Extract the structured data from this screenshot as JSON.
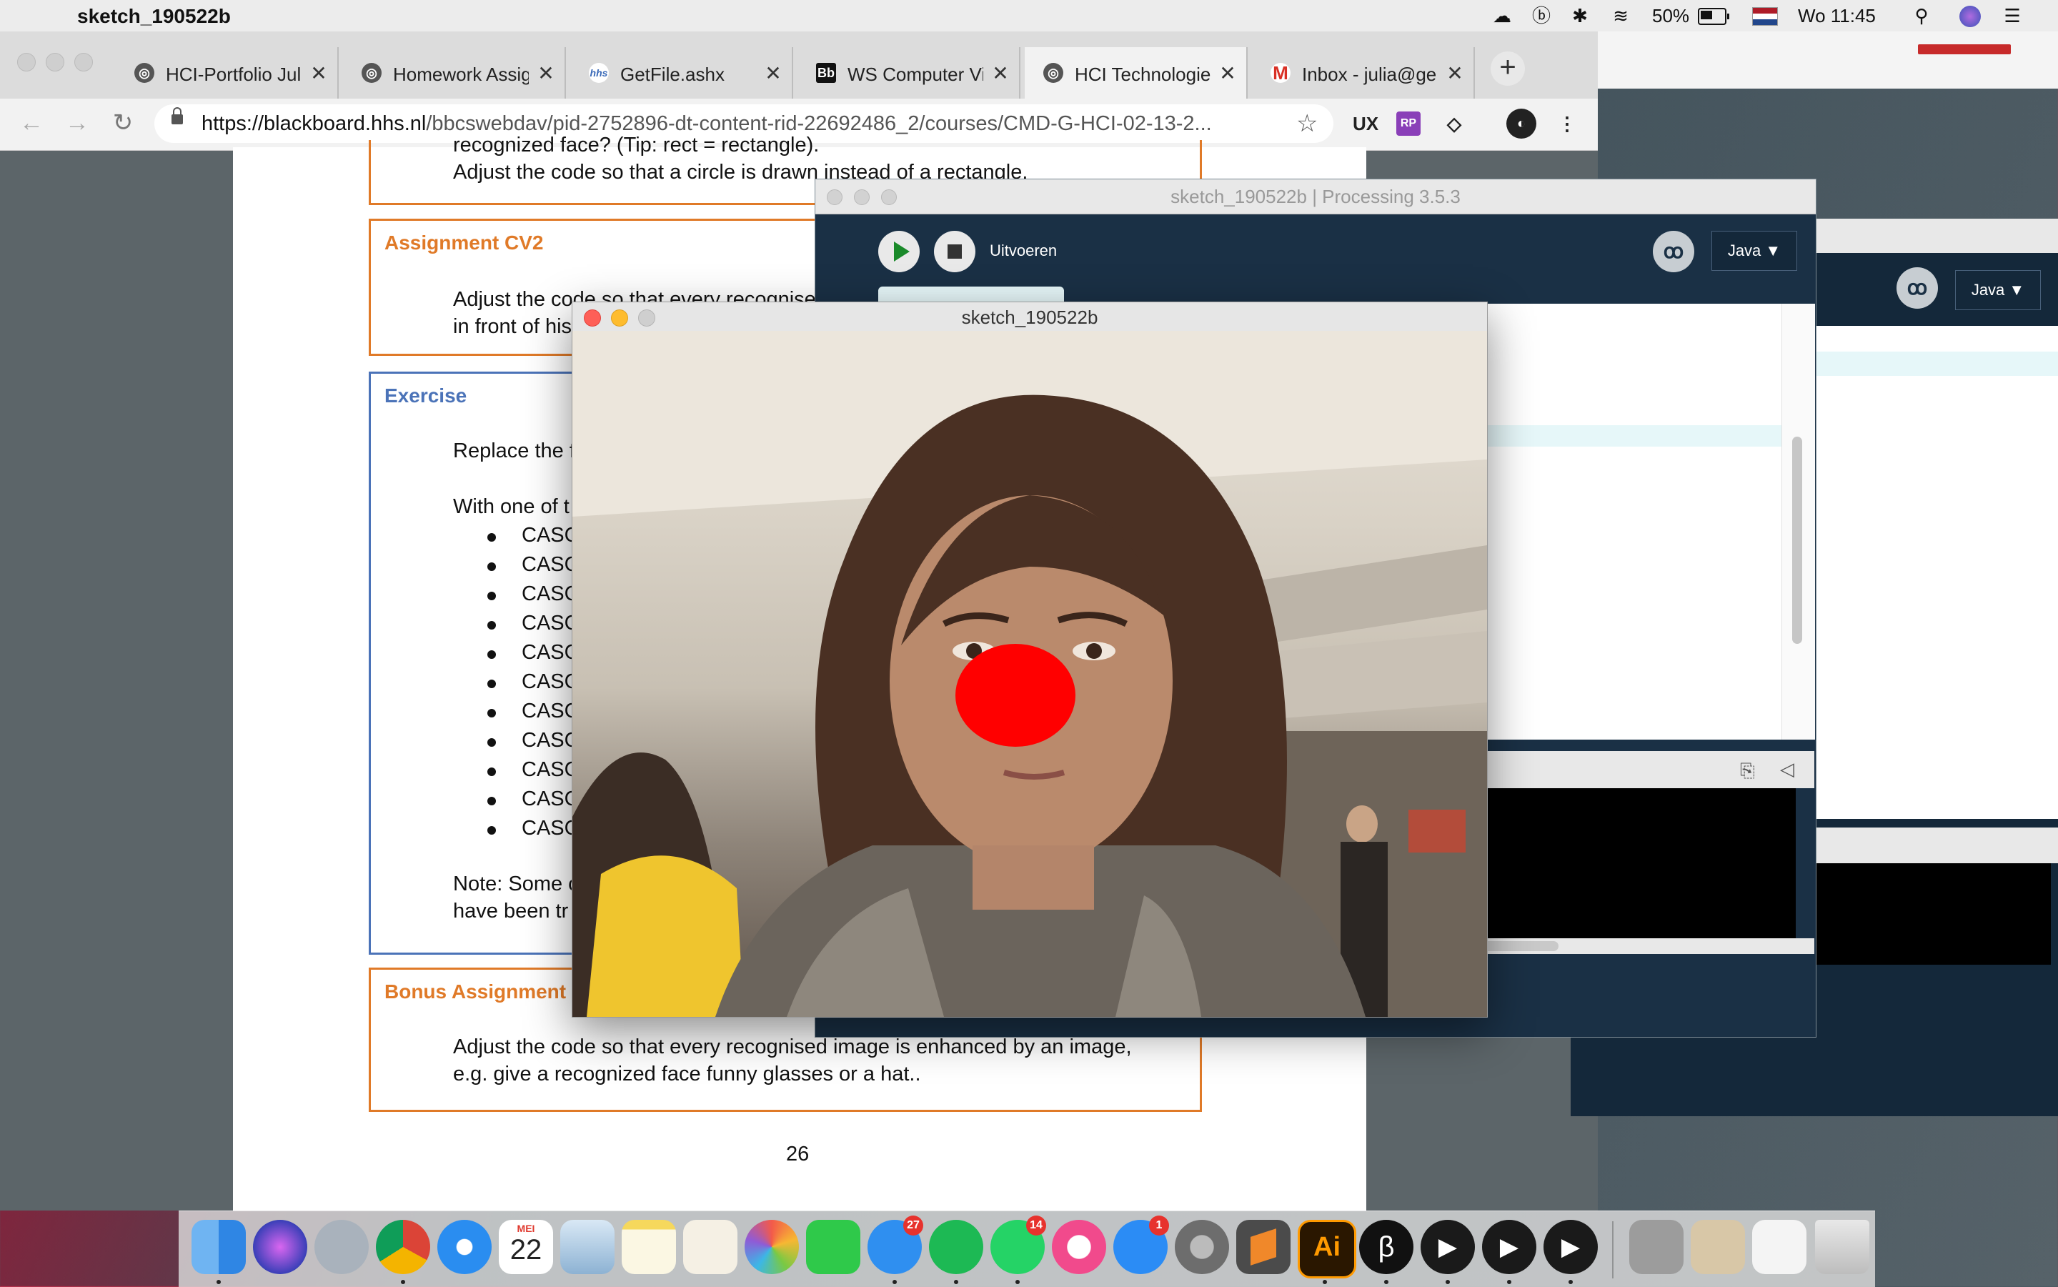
{
  "menubar": {
    "app_name": "sketch_190522b",
    "battery_pct": "50%",
    "clock": "Wo 11:45",
    "icons": [
      "creative-cloud-icon",
      "b-icon",
      "bluetooth-icon",
      "wifi-icon",
      "battery-icon",
      "flag-icon",
      "search-icon",
      "siri-icon",
      "list-icon"
    ]
  },
  "browser": {
    "tabs": [
      {
        "title": "HCI-Portfolio Jul",
        "favicon": "globe-icon"
      },
      {
        "title": "Homework Assig",
        "favicon": "globe-icon"
      },
      {
        "title": "GetFile.ashx",
        "favicon": "hhs-icon"
      },
      {
        "title": "WS Computer Vi",
        "favicon": "blackboard-icon"
      },
      {
        "title": "HCI Technologie",
        "favicon": "globe-icon"
      },
      {
        "title": "Inbox - julia@ge",
        "favicon": "gmail-icon"
      }
    ],
    "active_tab_index": 4,
    "url_host": "https://blackboard.hhs.nl",
    "url_path": "/bbcswebdav/pid-2752896-dt-content-rid-22692486_2/courses/CMD-G-HCI-02-13-2...",
    "extensions": [
      "UX",
      "RP",
      "◇",
      "◐"
    ]
  },
  "pdf": {
    "top_text_1": "recognized face? (Tip: rect = rectangle).",
    "top_text_2": "Adjust the code so that a circle is drawn instead of a rectangle.",
    "cv2_title": "Assignment CV2",
    "cv2_line1": "Adjust the code so that every recognised",
    "cv2_line2": "in front of his",
    "exercise_title": "Exercise",
    "exercise_line1": "Replace the f",
    "exercise_line2": "With one of t",
    "bullets": [
      "CASC",
      "CASC",
      "CASC",
      "CASC",
      "CASC",
      "CASC",
      "CASC",
      "CASC",
      "CASC",
      "CASC",
      "CASC"
    ],
    "note_line1": "Note: Some c",
    "note_line2": "have been tr",
    "bonus_title": "Bonus Assignment",
    "bonus_line1": "Adjust the code so that every recognised image is enhanced by an image,",
    "bonus_line2": "e.g. give a recognized face funny glasses or a hat..",
    "page_number": "26"
  },
  "ide": {
    "title": "sketch_190522b | Processing 3.5.3",
    "run_label": "Uitvoeren",
    "mode": "Java ▼",
    "back_mode": "Java ▼"
  },
  "sketch": {
    "title": "sketch_190522b",
    "nose_color": "#ff0000"
  },
  "dock": {
    "items": [
      "finder-icon",
      "siri-icon",
      "launchpad-icon",
      "chrome-icon",
      "safari-icon",
      "calendar-icon",
      "mail-icon",
      "notes-icon",
      "textedit-icon",
      "photos-icon",
      "facetime-icon",
      "messages-icon",
      "spotify-icon",
      "whatsapp-icon",
      "itunes-icon",
      "appstore-icon",
      "system-preferences-icon",
      "sublime-icon",
      "illustrator-icon",
      "processing-icon",
      "quicktime-icon",
      "quicktime-icon",
      "quicktime-icon"
    ],
    "calendar_month": "MEI",
    "calendar_day": "22",
    "badge_messages": "27",
    "badge_whatsapp": "14",
    "badge_appstore": "1",
    "illustrator_label": "Ai"
  }
}
